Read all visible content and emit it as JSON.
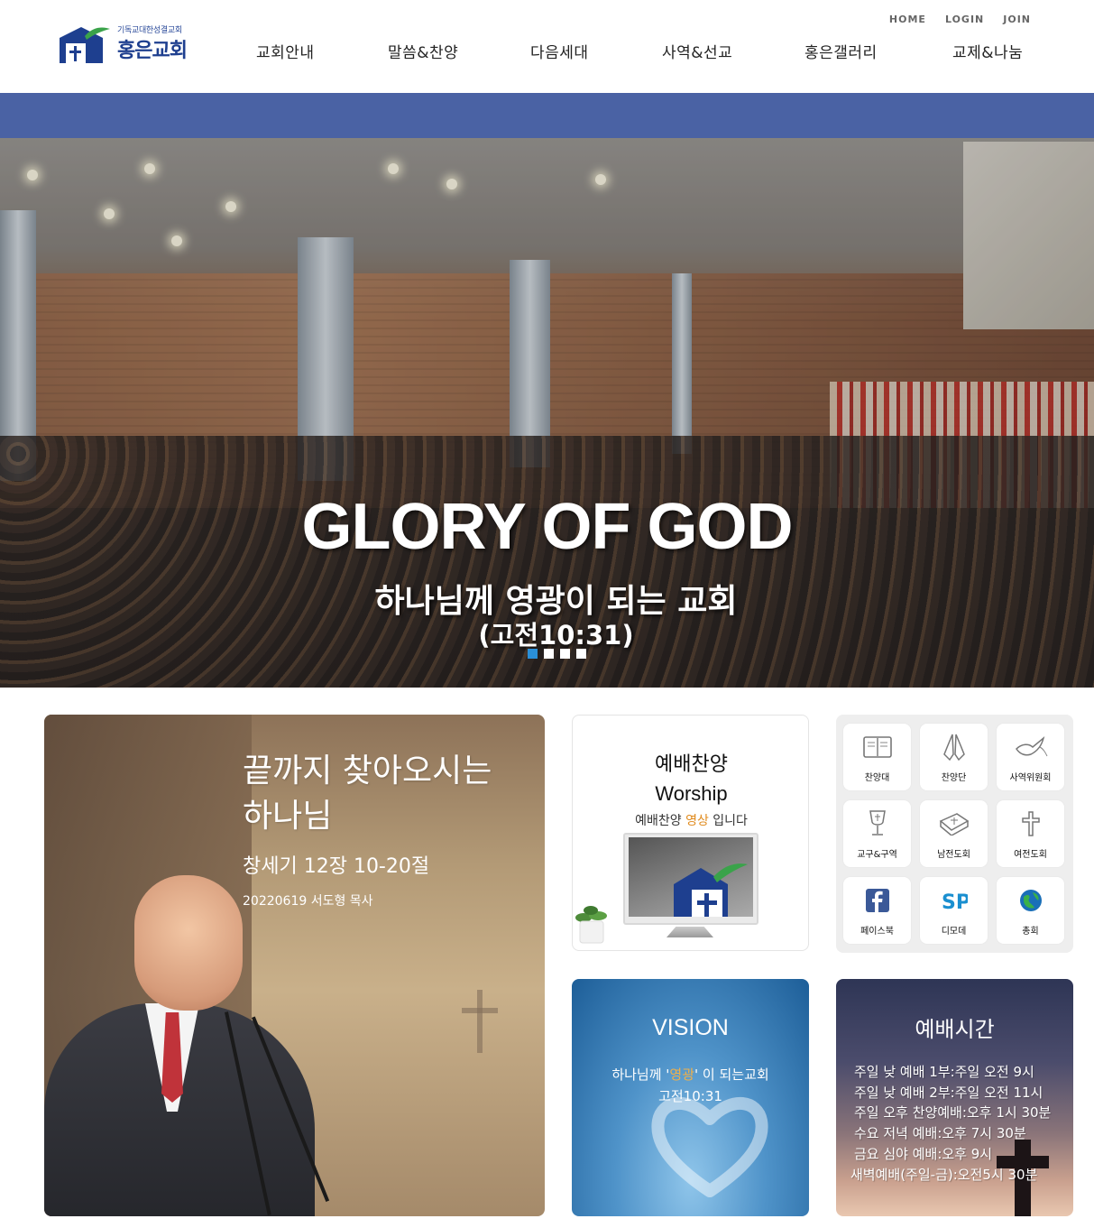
{
  "header": {
    "logo": {
      "subtitle": "기독교대한성결교회",
      "name": "홍은교회"
    },
    "util_links": [
      "HOME",
      "LOGIN",
      "JOIN"
    ],
    "nav": [
      "교회안내",
      "말씀&찬양",
      "다음세대",
      "사역&선교",
      "홍은갤러리",
      "교제&나눔"
    ]
  },
  "hero": {
    "title": "GLORY OF GOD",
    "subtitle": "하나님께 영광이 되는 교회",
    "reference": "(고전10:31)",
    "slides": 4,
    "active_slide": 1
  },
  "sermon": {
    "title": "끝까지 찾아오시는 하나님",
    "passage": "창세기 12장 10-20절",
    "meta": "20220619  서도형 목사"
  },
  "worship": {
    "title_ko": "예배찬양",
    "title_en": "Worship",
    "desc_before": "예배찬양 ",
    "desc_highlight": "영상",
    "desc_after": " 입니다"
  },
  "quick_links": [
    {
      "label": "찬양대",
      "icon": "book-icon"
    },
    {
      "label": "찬양단",
      "icon": "praying-hands-icon"
    },
    {
      "label": "사역위원회",
      "icon": "dove-icon"
    },
    {
      "label": "교구&구역",
      "icon": "chalice-icon"
    },
    {
      "label": "남전도회",
      "icon": "bible-icon"
    },
    {
      "label": "여전도회",
      "icon": "cross-icon"
    },
    {
      "label": "페이스북",
      "icon": "facebook-icon"
    },
    {
      "label": "디모데",
      "icon": "sp-logo-icon"
    },
    {
      "label": "총회",
      "icon": "globe-icon"
    }
  ],
  "vision": {
    "title": "VISION",
    "line1_before": "하나님께 '",
    "line1_highlight": "영광",
    "line1_after": "' 이 되는교회",
    "line2": "고전10:31"
  },
  "service_times": {
    "title": "예배시간",
    "items": [
      "주일 낮 예배 1부:주일 오전 9시",
      "주일 낮 예배 2부:주일 오전 11시",
      "주일 오후 찬양예배:오후 1시 30분",
      "수요 저녁 예배:오후 7시 30분",
      "금요 심야 예배:오후 9시",
      "새벽예배(주일-금):오전5시 30분"
    ]
  },
  "colors": {
    "band": "#4a62a4",
    "logo_blue": "#1e3f8f",
    "logo_green": "#3aa34a",
    "highlight_orange": "#e08a1c",
    "slide_active": "#2a8fd8"
  }
}
